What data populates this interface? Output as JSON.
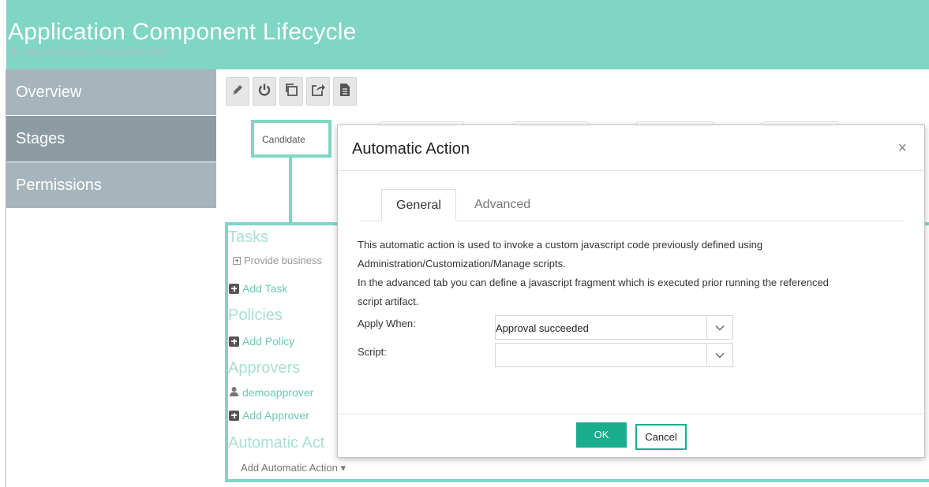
{
  "header": {
    "title": "Application Component Lifecycle",
    "subtitle": "Lifecycle Process, Published (In Use)",
    "subtitle_icon": "wrench-icon"
  },
  "sidebar": {
    "items": [
      {
        "label": "Overview",
        "active": false
      },
      {
        "label": "Stages",
        "active": true
      },
      {
        "label": "Permissions",
        "active": false
      }
    ]
  },
  "toolbar": {
    "icons": [
      "pencil-icon",
      "power-icon",
      "copy-icon",
      "export-icon",
      "document-icon"
    ]
  },
  "stage": {
    "name": "Candidate"
  },
  "sections": {
    "tasks": "Tasks",
    "task_item": "Provide business",
    "add_task": "Add Task",
    "policies": "Policies",
    "add_policy": "Add Policy",
    "approvers": "Approvers",
    "approver_item": "demoapprover",
    "add_approver": "Add Approver",
    "automatic_actions": "Automatic Act",
    "add_automatic_action": "Add Automatic Action ▾"
  },
  "modal": {
    "title": "Automatic Action",
    "close": "×",
    "tabs": [
      "General",
      "Advanced"
    ],
    "active_tab": "General",
    "description_lines": [
      "This automatic action is used to invoke a custom javascript code previously defined using",
      "Administration/Customization/Manage scripts.",
      "In the advanced tab you can define a javascript fragment which is executed prior running the referenced",
      "script artifact."
    ],
    "apply_when_label": "Apply When:",
    "apply_when_value": "Approval succeeded",
    "script_label": "Script:",
    "script_value": "",
    "ok_label": "OK",
    "cancel_label": "Cancel"
  },
  "colors": {
    "accent": "#7fd6c4",
    "sidebar": "#a6b5bb",
    "sidebar_active": "#8c9ba1",
    "primary_button": "#1aac8f"
  }
}
